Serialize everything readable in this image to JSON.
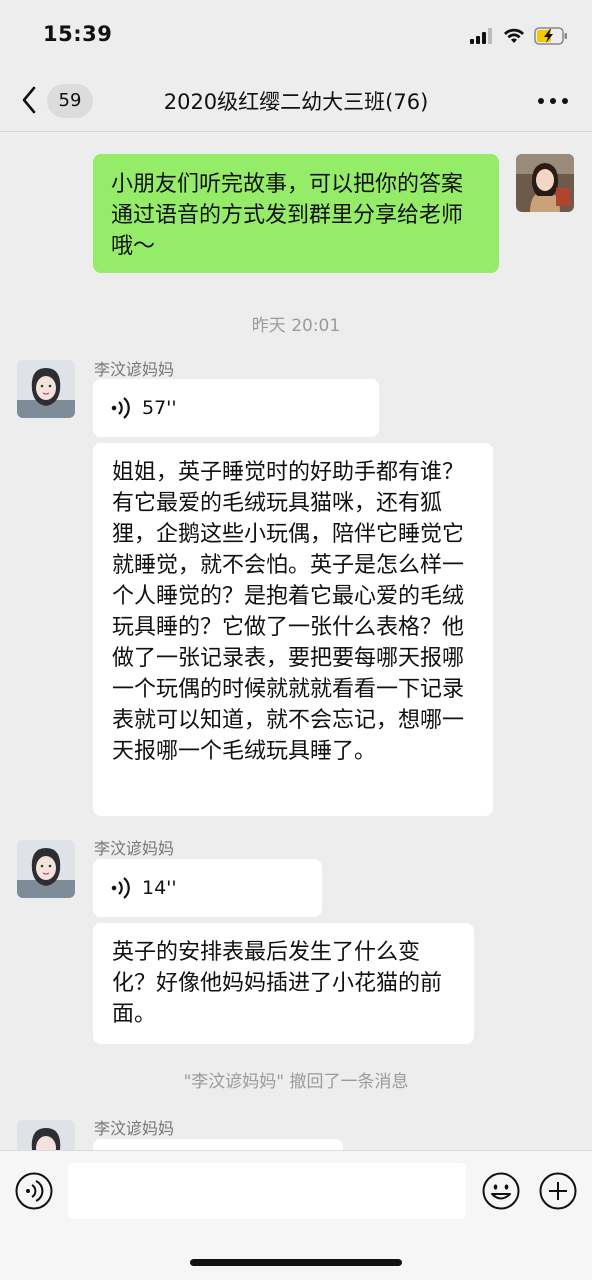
{
  "status": {
    "time": "15:39"
  },
  "nav": {
    "unread_count": "59",
    "title": "2020级红缨二幼大三班(76)"
  },
  "messages": {
    "m1_text": "小朋友们听完故事，可以把你的答案通过语音的方式发到群里分享给老师哦～",
    "timestamp": "昨天 20:01",
    "sender_1": "李汶谚妈妈",
    "voice_1": "57''",
    "text_1": "姐姐，英子睡觉时的好助手都有谁？有它最爱的毛绒玩具猫咪，还有狐狸，企鹅这些小玩偶，陪伴它睡觉它就睡觉，就不会怕。英子是怎么样一个人睡觉的？是抱着它最心爱的毛绒玩具睡的？它做了一张什么表格？他做了一张记录表，要把要每哪天报哪一个玩偶的时候就就就看看一下记录表就可以知道，就不会忘记，想哪一天报哪一个毛绒玩具睡了。",
    "sender_2": "李汶谚妈妈",
    "voice_2": "14''",
    "text_2": "英子的安排表最后发生了什么变化？好像他妈妈插进了小花猫的前面。",
    "recall_note": "\"李汶谚妈妈\" 撤回了一条消息",
    "sender_3": "李汶谚妈妈"
  },
  "input": {
    "placeholder": ""
  },
  "colors": {
    "green_bubble": "#95ec69",
    "background": "#ededed"
  }
}
